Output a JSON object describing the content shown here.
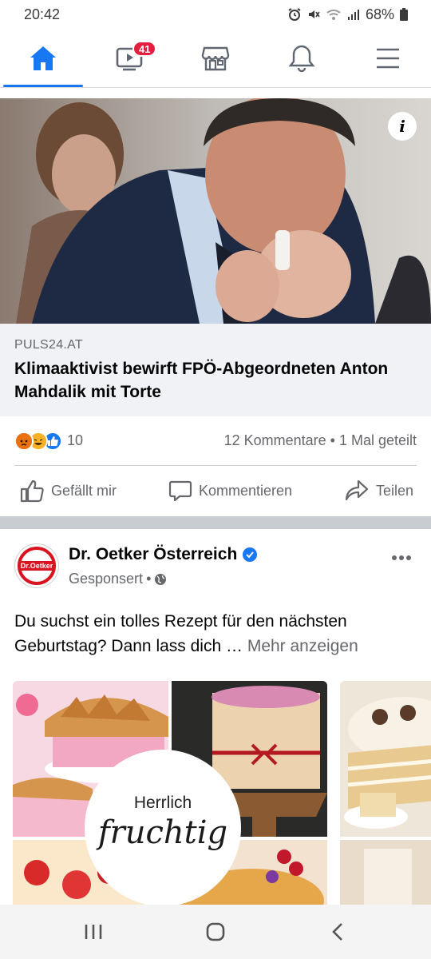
{
  "status_bar": {
    "time": "20:42",
    "battery": "68%"
  },
  "top_nav": {
    "items": [
      {
        "icon": "home-icon",
        "active": true
      },
      {
        "icon": "video-icon",
        "badge": "41"
      },
      {
        "icon": "marketplace-icon"
      },
      {
        "icon": "bell-icon"
      },
      {
        "icon": "menu-icon"
      }
    ]
  },
  "post1": {
    "link_source": "PULS24.AT",
    "link_title": "Klimaaktivist bewirft FPÖ-Abgeordneten Anton Mahdalik mit Torte",
    "reaction_count": "10",
    "comments_shares": "12 Kommentare • 1 Mal geteilt",
    "actions": {
      "like": "Gefällt mir",
      "comment": "Kommentieren",
      "share": "Teilen"
    }
  },
  "post2": {
    "page_name": "Dr. Oetker Österreich",
    "avatar_text": "Dr.Oetker",
    "sponsored": "Gesponsert",
    "text": "Du suchst ein tolles Rezept für den nächsten Geburtstag? Dann lass dich … ",
    "more_link": "Mehr anzeigen",
    "card_text_line1": "Herrlich",
    "card_text_line2": "fruchtig"
  },
  "colors": {
    "accent": "#1877f2",
    "badge": "#e41e3f",
    "secondary_text": "#65676b",
    "brand_red": "#d9141f"
  }
}
